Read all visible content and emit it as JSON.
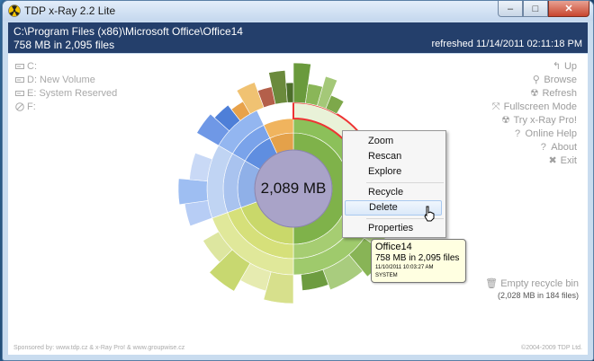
{
  "window": {
    "title": "TDP x-Ray 2.2 Lite",
    "minimize": "–",
    "maximize": "□",
    "close": "✕"
  },
  "header": {
    "path": "C:\\Program Files (x86)\\Microsoft Office\\Office14",
    "summary": "758 MB in 2,095 files",
    "refreshed": "refreshed 11/14/2011 02:11:18 PM"
  },
  "drives": [
    {
      "label": "C:",
      "icon": "drive-icon"
    },
    {
      "label": "D: New Volume",
      "icon": "drive-icon"
    },
    {
      "label": "E: System Reserved",
      "icon": "drive-icon"
    },
    {
      "label": "F:",
      "icon": "disc-icon"
    }
  ],
  "actions": [
    {
      "label": "Up",
      "icon": "up-icon"
    },
    {
      "label": "Browse",
      "icon": "search-icon"
    },
    {
      "label": "Refresh",
      "icon": "refresh-icon"
    },
    {
      "label": "Fullscreen Mode",
      "icon": "fullscreen-icon"
    },
    {
      "label": "Try x-Ray Pro!",
      "icon": "xray-icon"
    },
    {
      "label": "Online Help",
      "icon": "help-icon"
    },
    {
      "label": "About",
      "icon": "about-icon"
    },
    {
      "label": "Exit",
      "icon": "exit-icon"
    }
  ],
  "chart_center": "2,089 MB",
  "context_menu": {
    "items": [
      "Zoom",
      "Rescan",
      "Explore",
      "Recycle",
      "Delete",
      "Properties"
    ],
    "highlighted": "Delete"
  },
  "tooltip": {
    "title": "Office14",
    "size": "758 MB in 2,095 files",
    "date": "11/10/2011 10:03:27 AM",
    "attr": "SYSTEM"
  },
  "recycle": {
    "label": "Empty recycle bin",
    "sub": "(2,028 MB in 184 files)"
  },
  "footer": {
    "sponsor": "Sponsored by: www.tdp.cz & x-Ray Pro! & www.groupwise.cz",
    "copyright": "©2004-2009 TDP Ltd."
  },
  "colors": {
    "header_bg": "#243f6b",
    "highlight": "#dbe9f9",
    "center": "#a9a3c8"
  }
}
